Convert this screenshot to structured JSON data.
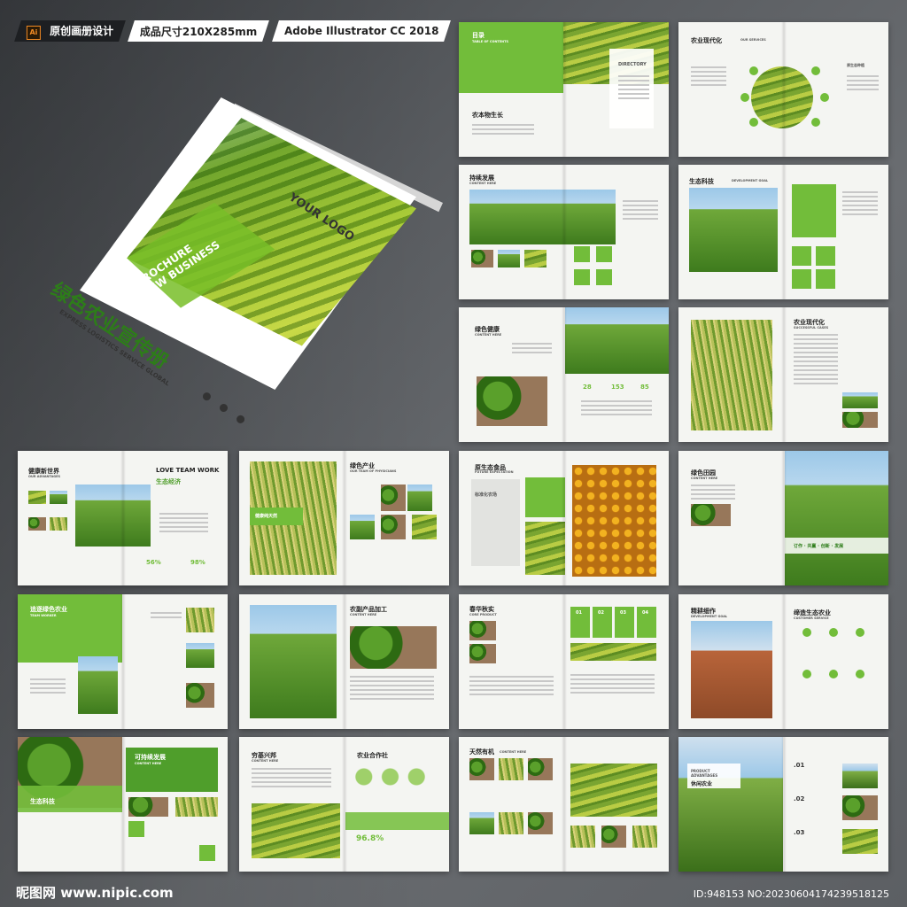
{
  "header": {
    "ai_badge": "Ai",
    "design_label": "原创画册设计",
    "size_label": "成品尺寸210X285mm",
    "software_label": "Adobe Illustrator CC 2018"
  },
  "cover": {
    "title": "绿色农业宣传册",
    "subtitle": "EXPRESS LOGISTICS SERVICE GLOBAL",
    "brochure": "BROCHURE\nNEW BUSINESS",
    "logo": "YOUR LOGO"
  },
  "spreads": [
    {
      "title": "目录",
      "en": "TABLE OF CONTENTS",
      "extra": "DIRECTORY",
      "sub": "农本物生长"
    },
    {
      "title": "农业现代化",
      "en": "OUR SERVICES",
      "extra": "原生态种植"
    },
    {
      "title": "持续发展",
      "en": "CONTENT HERE"
    },
    {
      "title": "生态科技",
      "en": "DEVELOPMENT GOAL"
    },
    {
      "title": "绿色健康",
      "en": "CONTENT HERE",
      "stats": [
        "28",
        "153",
        "85"
      ]
    },
    {
      "title": "农业现代化",
      "en": "SUCCESSFUL CASES"
    },
    {
      "title": "健康新世界",
      "en": "OUR ADVANTAGES",
      "extra": "LOVE TEAM WORK",
      "sub": "生态经济",
      "stats": [
        "56%",
        "98%"
      ]
    },
    {
      "title": "绿色产业",
      "en": "OUR TEAM OF PHYSICIANS",
      "extra": "健康纯天然"
    },
    {
      "title": "原生态食品",
      "en": "FUTURE EXPECTATION",
      "sub": "标准化农场"
    },
    {
      "title": "绿色田园",
      "en": "CONTENT HERE",
      "sub": "订作 · 共赢 · 创新 · 发展"
    },
    {
      "title": "追逐绿色农业",
      "en": "TEAM WORKER"
    },
    {
      "title": "农副产品加工",
      "en": "CONTENT HERE"
    },
    {
      "title": "春华秋实",
      "en": "CORE PRODUCT",
      "stats": [
        "01",
        "02",
        "03",
        "04"
      ]
    },
    {
      "title": "精耕细作",
      "en": "DEVELOPMENT GOAL",
      "extra": "缔造生态农业",
      "sub": "CUSTOMER SERVICE"
    },
    {
      "title": "可持续发展",
      "en": "CONTENT HERE",
      "sub": "生态科技"
    },
    {
      "title": "穷基兴邦",
      "en": "CONTENT HERE",
      "extra": "农业合作社",
      "stats": [
        "96.8%"
      ]
    },
    {
      "title": "天然有机",
      "en": "CONTENT HERE"
    },
    {
      "title": "PRODUCT ADVANTAGES",
      "en": "休闲农业",
      "stats": [
        ".01",
        ".02",
        ".03"
      ]
    }
  ],
  "footer": {
    "site": "昵图网 www.nipic.com",
    "id": "ID:948153 NO:20230604174239518125"
  }
}
